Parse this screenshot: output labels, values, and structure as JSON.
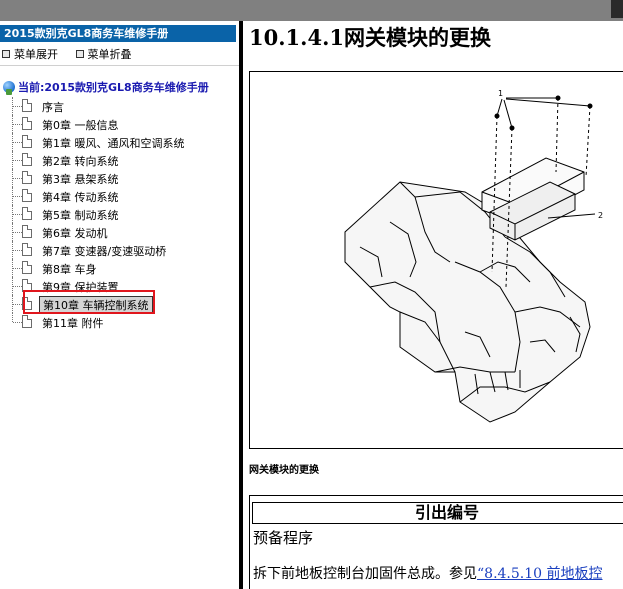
{
  "book_title": "2015款别克GL8商务车维修手册",
  "menu_ops": {
    "expand": "菜单展开",
    "collapse": "菜单折叠"
  },
  "current_label": "当前:2015款别克GL8商务车维修手册",
  "tree_items": [
    "序言",
    "第0章 一般信息",
    "第1章 暖风、通风和空调系统",
    "第2章 转向系统",
    "第3章 悬架系统",
    "第4章 传动系统",
    "第5章 制动系统",
    "第6章 发动机",
    "第7章 变速器/变速驱动桥",
    "第8章 车身",
    "第9章 保护装置",
    "第10章 车辆控制系统",
    "第11章 附件"
  ],
  "selected_index": 11,
  "doc": {
    "title": "10.1.4.1网关模块的更换",
    "figure_callouts": [
      "1",
      "2"
    ],
    "caption": "网关模块的更换",
    "table_header": "引出编号",
    "prep_label": "预备程序",
    "step_text": "拆下前地板控制台加固件总成。参见",
    "step_link": "“8.4.5.10 前地板控"
  },
  "colors": {
    "title_bar_bg": "#0a63a8",
    "current_text": "#1a1ab0",
    "highlight_border": "#e0161d",
    "link": "#1a3fbf"
  }
}
